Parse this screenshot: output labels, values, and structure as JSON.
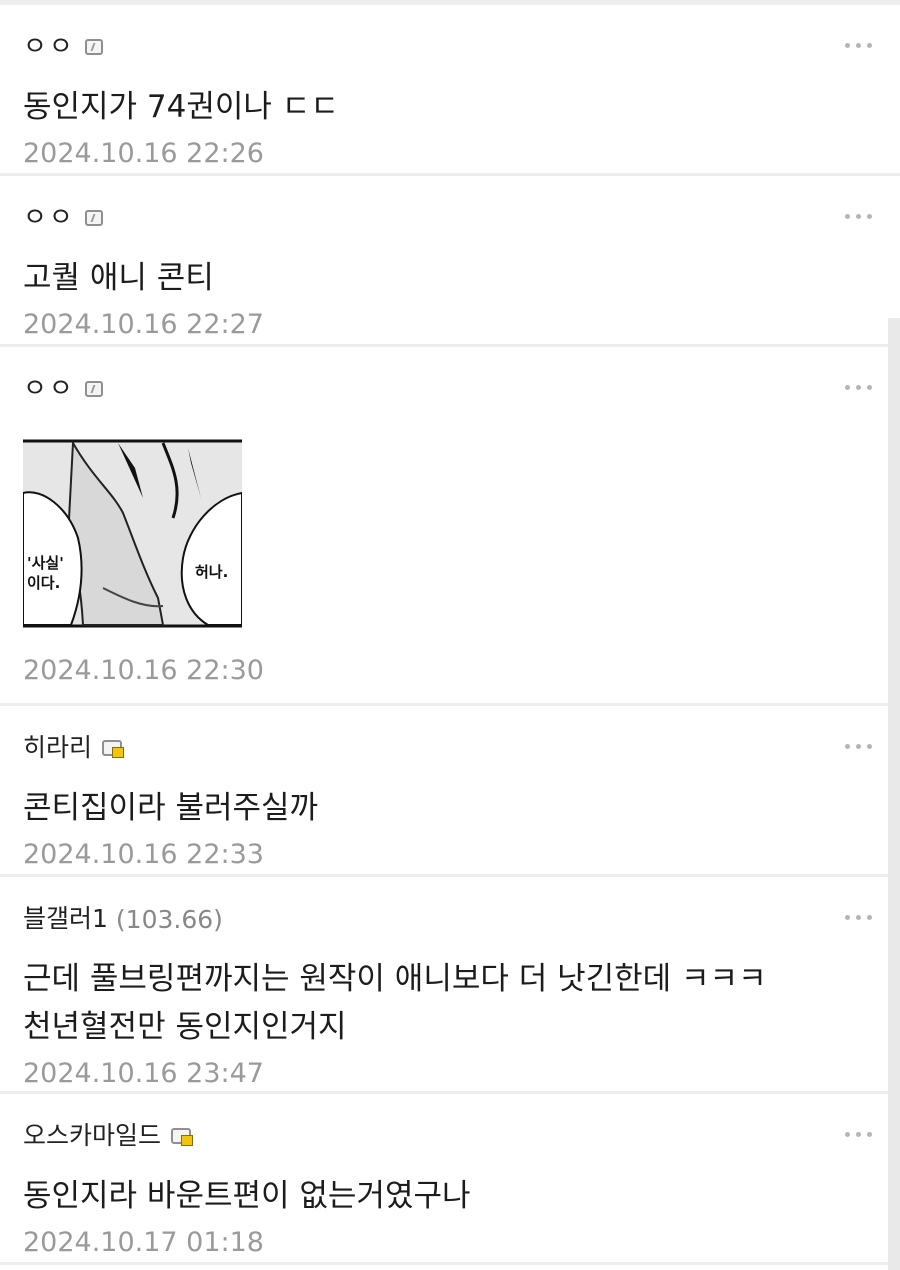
{
  "comments": [
    {
      "author": "ㅇㅇ",
      "author_icon": "fixed-nick-icon",
      "text": "동인지가 74권이나 ㄷㄷ",
      "timestamp": "2024.10.16 22:26"
    },
    {
      "author": "ㅇㅇ",
      "author_icon": "fixed-nick-icon",
      "text": "고퀄 애니 콘티",
      "timestamp": "2024.10.16 22:27"
    },
    {
      "author": "ㅇㅇ",
      "author_icon": "fixed-nick-icon",
      "attachment": {
        "bubble_left_line1": "'사실'",
        "bubble_left_line2": "이다.",
        "bubble_right": "허나."
      },
      "timestamp": "2024.10.16 22:30"
    },
    {
      "author": "히라리",
      "author_icon": "half-fixed-nick-icon",
      "text": "콘티집이라 불러주실까",
      "timestamp": "2024.10.16 22:33"
    },
    {
      "author": "블갤러1",
      "score": "(103.66)",
      "text_lines": [
        "근데 풀브링편까지는 원작이 애니보다 더 낫긴한데 ㅋㅋㅋ",
        "천년혈전만 동인지인거지"
      ],
      "timestamp": "2024.10.16 23:47"
    },
    {
      "author": "오스카마일드",
      "author_icon": "half-fixed-nick-icon",
      "text": "동인지라 바운트편이 없는거였구나",
      "timestamp": "2024.10.17 01:18"
    }
  ],
  "more_icon": "more-dots-icon"
}
